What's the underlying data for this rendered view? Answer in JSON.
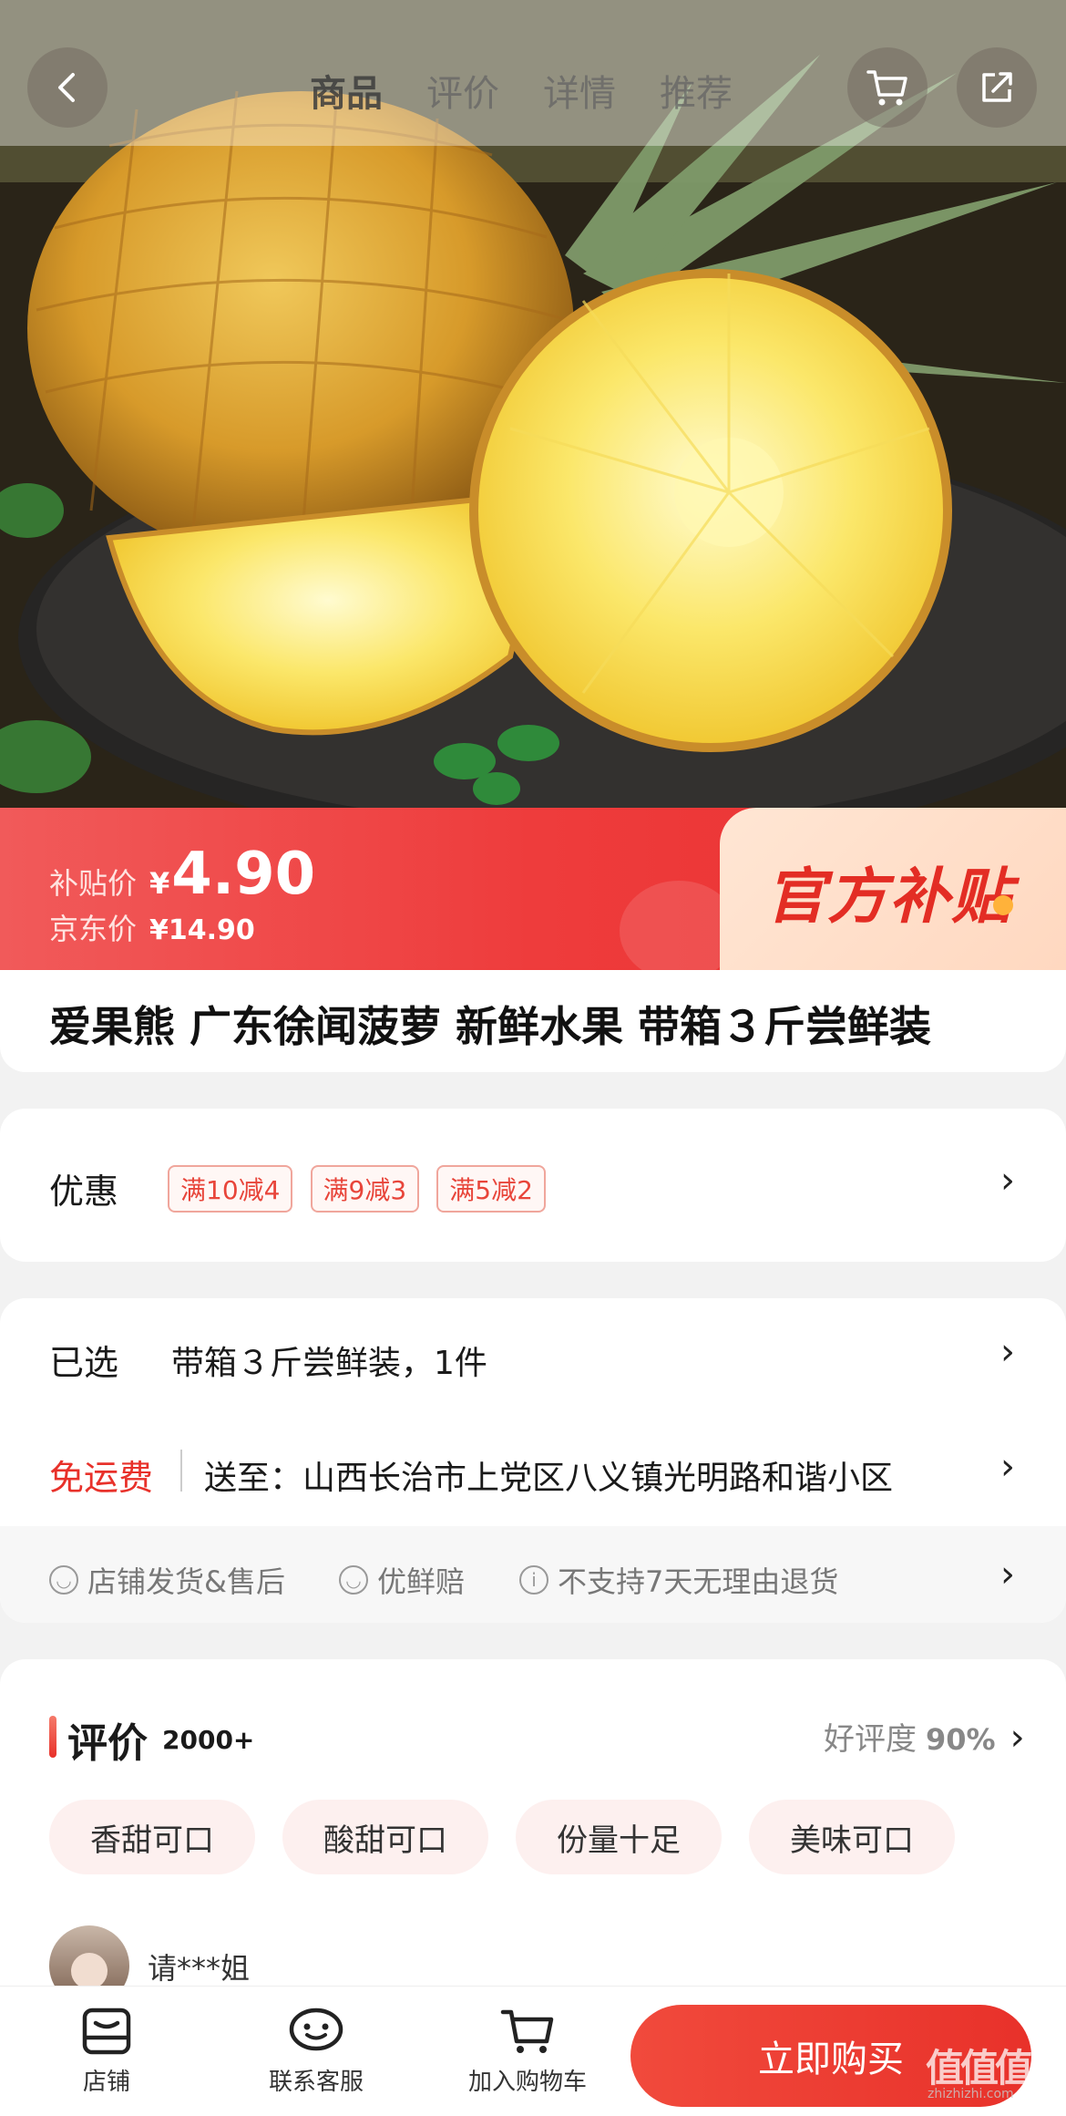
{
  "header": {
    "tabs": [
      "商品",
      "评价",
      "详情",
      "推荐"
    ],
    "active_tab": "商品"
  },
  "price": {
    "subsidy_label": "补贴价",
    "currency": "¥",
    "subsidy_price": "4.90",
    "jd_label": "京东价",
    "jd_price": "¥14.90",
    "slogan": "官方补贴"
  },
  "product": {
    "title": "爱果熊 广东徐闻菠萝 新鲜水果 带箱３斤尝鲜装"
  },
  "promo": {
    "label": "优惠",
    "coupons": [
      "满10减4",
      "满9减3",
      "满5减2"
    ]
  },
  "selection": {
    "label": "已选",
    "value": "带箱３斤尝鲜装，1件"
  },
  "shipping": {
    "label": "免运费",
    "address": "送至：山西长治市上党区八义镇光明路和谐小区"
  },
  "services": [
    {
      "icon": "smile-icon",
      "text": "店铺发货&售后"
    },
    {
      "icon": "smile-icon",
      "text": "优鲜赔"
    },
    {
      "icon": "info-icon",
      "text": "不支持7天无理由退货"
    }
  ],
  "reviews": {
    "title": "评价",
    "count": "2000+",
    "rating_label": "好评度",
    "rating": "90%",
    "tags": [
      "香甜可口",
      "酸甜可口",
      "份量十足",
      "美味可口"
    ],
    "first_reviewer": "请***姐"
  },
  "bottom_bar": {
    "store": "店铺",
    "service": "联系客服",
    "cart": "加入购物车",
    "buy": "立即购买",
    "watermark": "值值值",
    "watermark_sub": "zhizhizhi.com"
  },
  "colors": {
    "accent_red": "#e8312a",
    "coupon_red": "#e8453a"
  }
}
